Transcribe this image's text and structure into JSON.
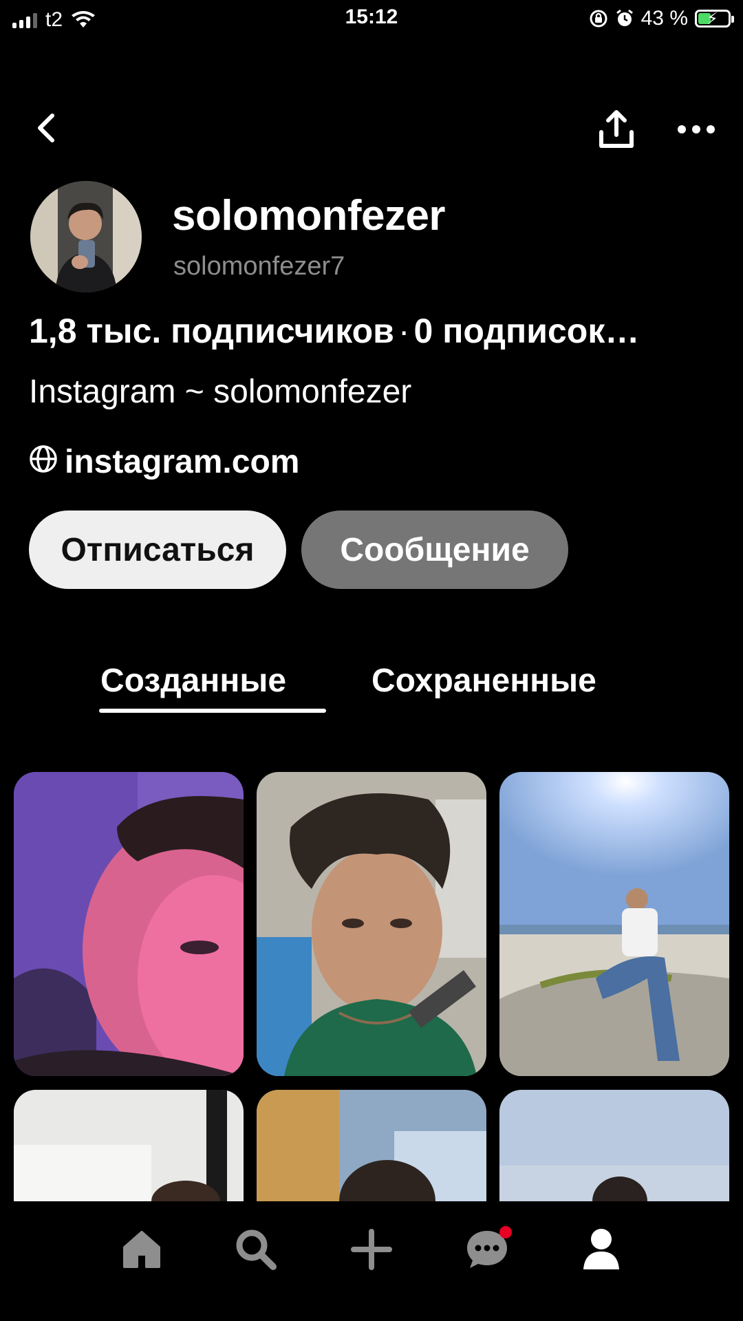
{
  "status_bar": {
    "carrier": "t2",
    "time": "15:12",
    "battery_percent": "43 %",
    "battery_level": 0.43
  },
  "profile": {
    "display_name": "solomonfezer",
    "username": "solomonfezer7",
    "followers": "1,8 тыс. подписчиков",
    "separator": "·",
    "following": "0 подписок…",
    "bio": "Instagram ~ solomonfezer",
    "link": "instagram.com"
  },
  "actions": {
    "unfollow_label": "Отписаться",
    "message_label": "Сообщение"
  },
  "tabs": [
    {
      "label": "Созданные",
      "active": true
    },
    {
      "label": "Сохраненные",
      "active": false
    }
  ],
  "colors": {
    "background": "#000000",
    "unfollow_bg": "#efefef",
    "message_bg": "#767676",
    "notification_dot": "#e60023",
    "battery_green": "#4cd964"
  },
  "nav": {
    "items": [
      "home-icon",
      "search-icon",
      "plus-icon",
      "chat-bubble-icon",
      "profile-icon"
    ],
    "messages_badge": true
  }
}
